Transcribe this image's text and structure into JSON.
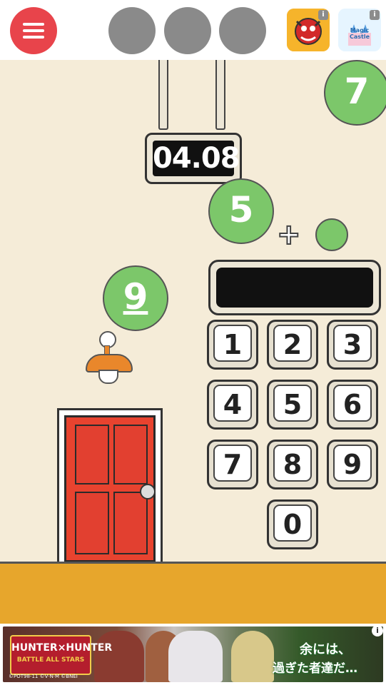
{
  "top_bar": {
    "ad_icon_1_badge": "i",
    "ad_icon_2_badge": "i",
    "ad_icon_2_label": "Magic Castle"
  },
  "scene": {
    "timer_display": "04.08",
    "bubbles": [
      "7",
      "5",
      "9",
      ""
    ],
    "plus_sign": "+",
    "keypad": [
      "1",
      "2",
      "3",
      "4",
      "5",
      "6",
      "7",
      "8",
      "9",
      "0"
    ]
  },
  "banner": {
    "logo_title": "HUNTER×HUNTER",
    "logo_tag": "BATTLE ALL STARS",
    "line1": "余には、",
    "line2": "過ぎた者達だ…",
    "copyright": "©POT98-11 ©V·N·M ©BNEI",
    "info": "i"
  },
  "colors": {
    "menu_red": "#e8444b",
    "bubble_green": "#7cc76a",
    "floor_orange": "#e7a62c",
    "door_red": "#e8432f",
    "wall": "#f5ecd8"
  }
}
